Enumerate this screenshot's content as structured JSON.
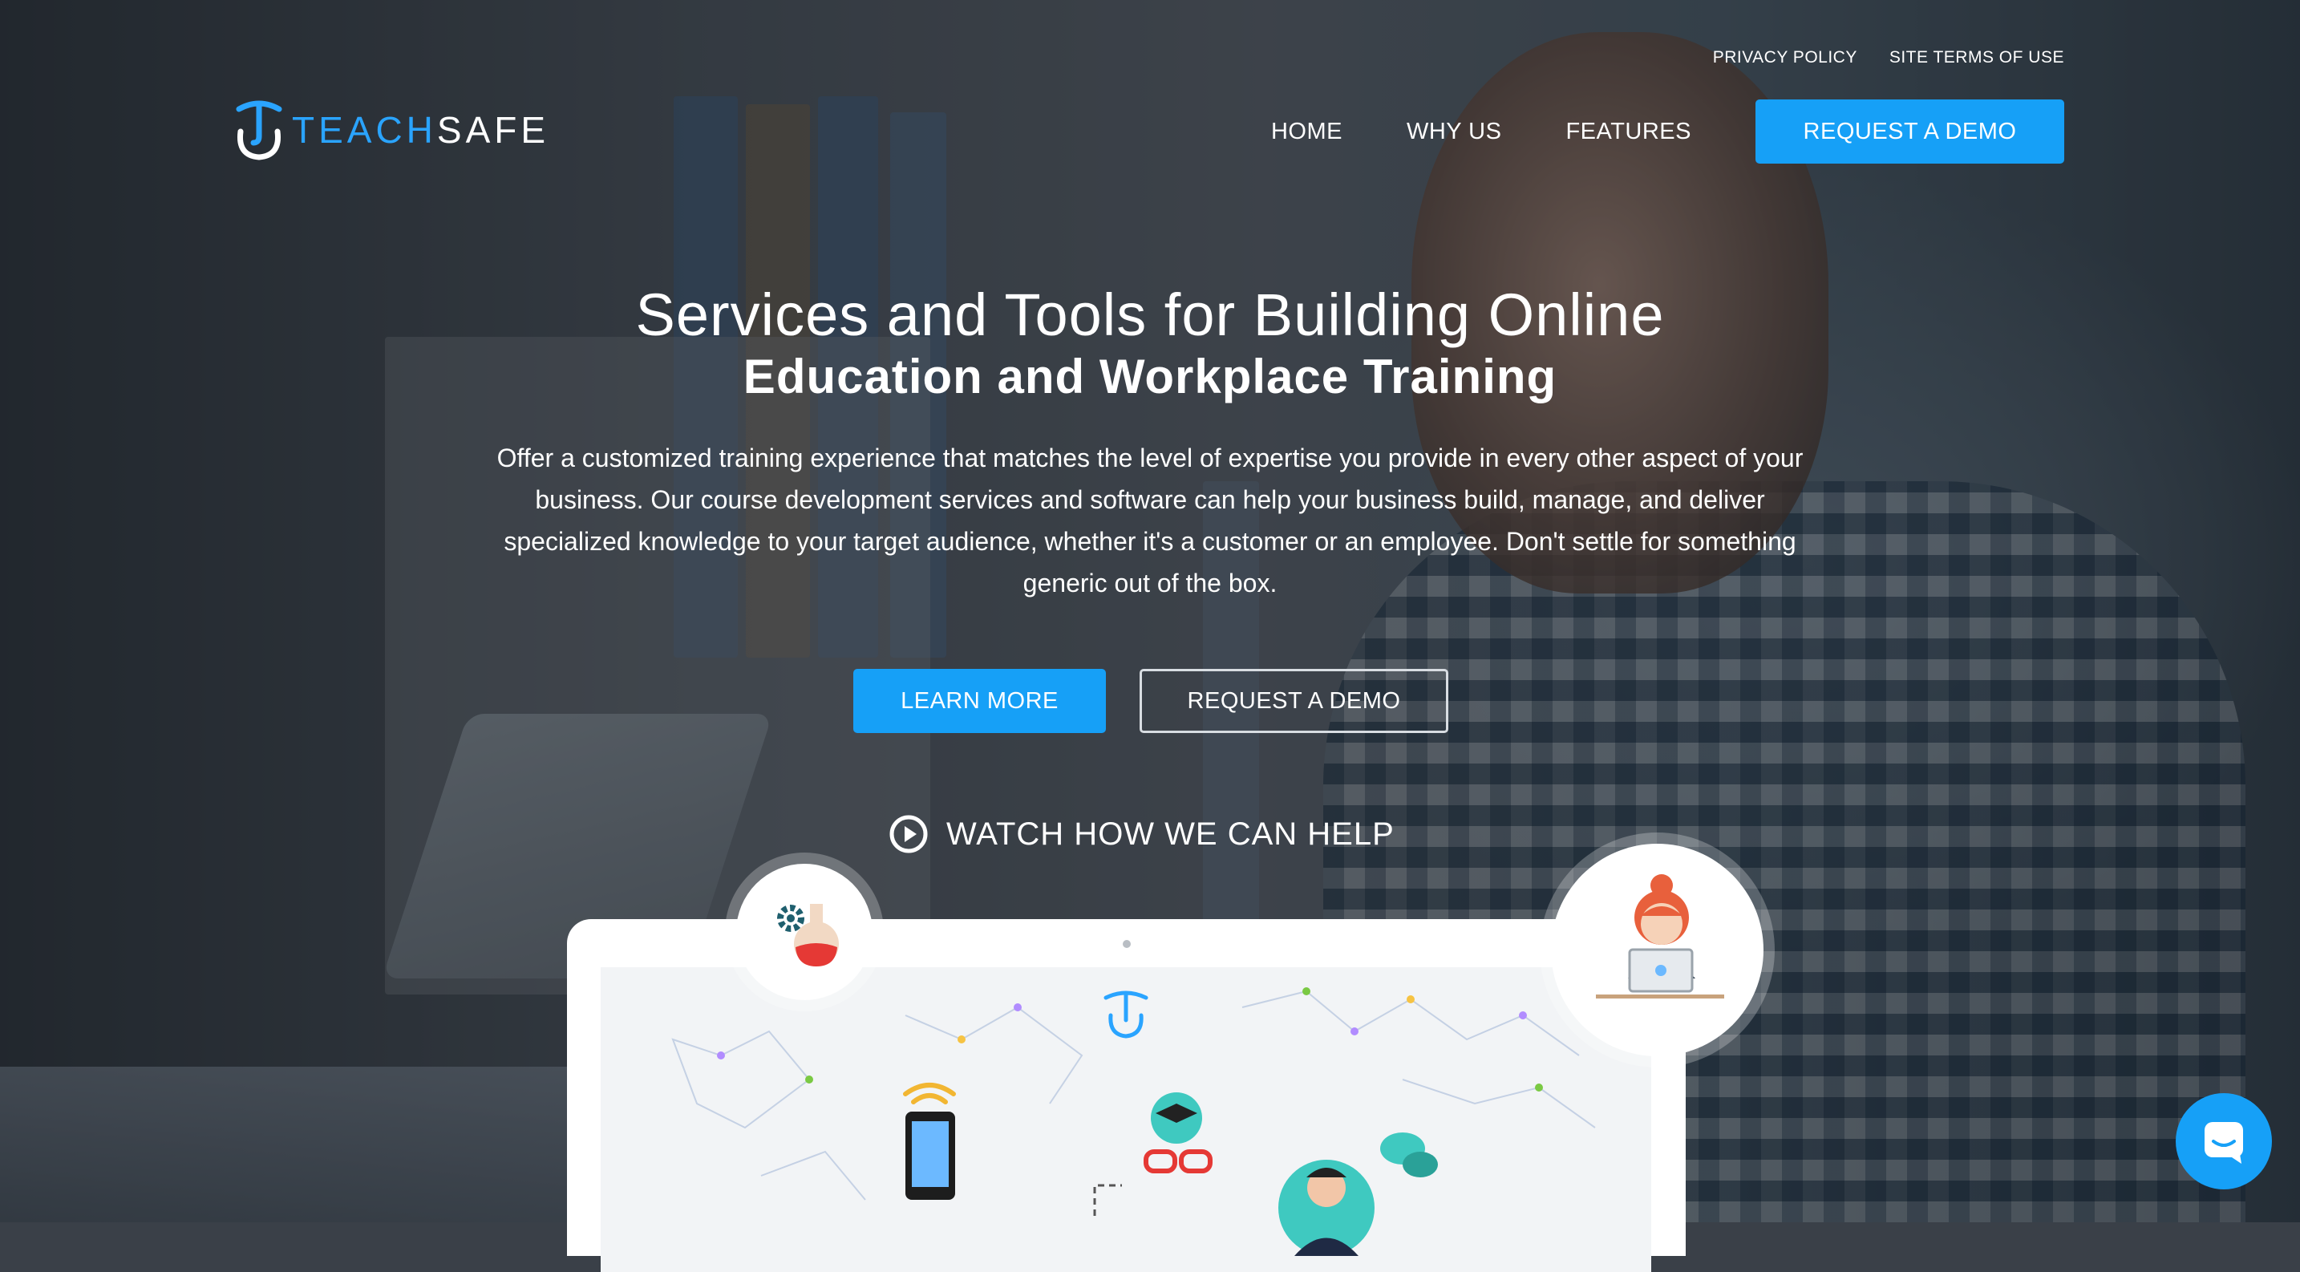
{
  "header": {
    "top_links": [
      "PRIVACY POLICY",
      "SITE TERMS OF USE"
    ],
    "logo": {
      "part1": "TEACH",
      "part2": "SAFE"
    },
    "nav": [
      "HOME",
      "WHY US",
      "FEATURES"
    ],
    "cta": "REQUEST A DEMO"
  },
  "hero": {
    "title_line1": "Services and Tools for Building Online",
    "title_line2": "Education and Workplace Training",
    "description": "Offer a customized training experience that matches the level of expertise you provide in every other aspect of your business. Our course development services and software can help your business build, manage, and deliver specialized knowledge to your target audience, whether it's a customer or an employee. Don't settle for something generic out of the box.",
    "learn_more": "LEARN MORE",
    "request_demo": "REQUEST A DEMO",
    "watch": "WATCH HOW WE CAN HELP"
  },
  "colors": {
    "brand_blue": "#16a0f7",
    "logo_blue": "#2aa4ff"
  },
  "icons": [
    "logo-icon",
    "play-icon",
    "flask-gear-icon",
    "worker-laptop-icon",
    "chat-icon"
  ]
}
